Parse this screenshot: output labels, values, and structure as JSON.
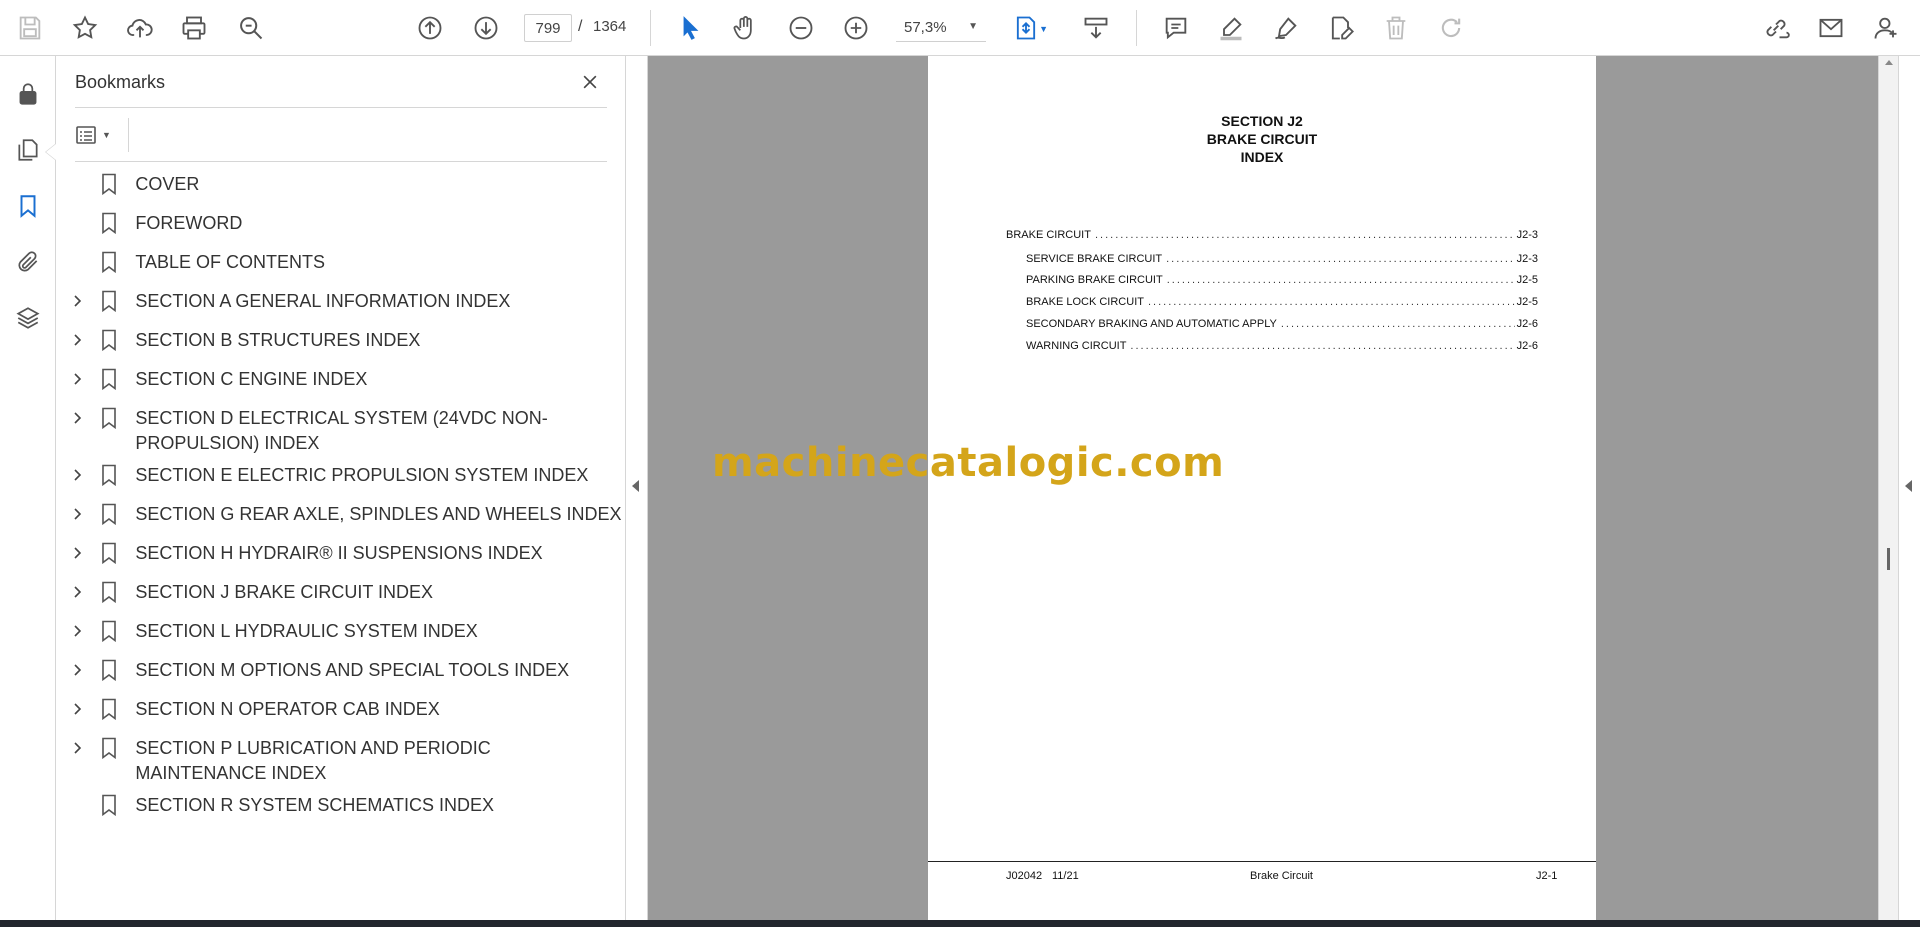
{
  "toolbar": {
    "current_page": "799",
    "page_separator": "/",
    "total_pages": "1364",
    "zoom": "57,3%"
  },
  "bookmarks_panel": {
    "title": "Bookmarks",
    "items": [
      {
        "label": "COVER",
        "expandable": false
      },
      {
        "label": "FOREWORD",
        "expandable": false
      },
      {
        "label": "TABLE OF CONTENTS",
        "expandable": false
      },
      {
        "label": "SECTION A GENERAL INFORMATION INDEX",
        "expandable": true
      },
      {
        "label": "SECTION B STRUCTURES INDEX",
        "expandable": true
      },
      {
        "label": "SECTION C ENGINE INDEX",
        "expandable": true
      },
      {
        "label": "SECTION D ELECTRICAL SYSTEM (24VDC NON-PROPULSION) INDEX",
        "expandable": true
      },
      {
        "label": "SECTION E ELECTRIC PROPULSION SYSTEM INDEX",
        "expandable": true
      },
      {
        "label": "SECTION G REAR AXLE, SPINDLES AND WHEELS INDEX",
        "expandable": true
      },
      {
        "label": "SECTION H HYDRAIR® II SUSPENSIONS INDEX",
        "expandable": true
      },
      {
        "label": "SECTION J BRAKE CIRCUIT INDEX",
        "expandable": true
      },
      {
        "label": "SECTION L HYDRAULIC SYSTEM INDEX",
        "expandable": true
      },
      {
        "label": "SECTION M OPTIONS AND SPECIAL TOOLS INDEX",
        "expandable": true
      },
      {
        "label": "SECTION N OPERATOR CAB INDEX",
        "expandable": true
      },
      {
        "label": "SECTION P LUBRICATION AND PERIODIC MAINTENANCE INDEX",
        "expandable": true
      },
      {
        "label": "SECTION R SYSTEM SCHEMATICS INDEX",
        "expandable": false
      }
    ]
  },
  "document": {
    "heading_lines": [
      "SECTION J2",
      "BRAKE CIRCUIT",
      "INDEX"
    ],
    "toc": [
      {
        "title": "BRAKE CIRCUIT",
        "page": "J2-3",
        "indent": false
      },
      {
        "title": "SERVICE BRAKE CIRCUIT",
        "page": "J2-3",
        "indent": true
      },
      {
        "title": "PARKING BRAKE CIRCUIT",
        "page": "J2-5",
        "indent": true
      },
      {
        "title": "BRAKE LOCK CIRCUIT",
        "page": "J2-5",
        "indent": true
      },
      {
        "title": "SECONDARY BRAKING AND AUTOMATIC APPLY",
        "page": "J2-6",
        "indent": true
      },
      {
        "title": "WARNING CIRCUIT",
        "page": "J2-6",
        "indent": true
      }
    ],
    "footer": {
      "doc_code": "J02042",
      "date": "11/21",
      "section_title": "Brake Circuit",
      "page_number": "J2-1"
    }
  },
  "watermark": "machinecatalogic.com",
  "colors": {
    "accent_blue": "#1a6fd1",
    "watermark_gold": "#d4a51a",
    "doc_background": "#9a9a9a"
  }
}
